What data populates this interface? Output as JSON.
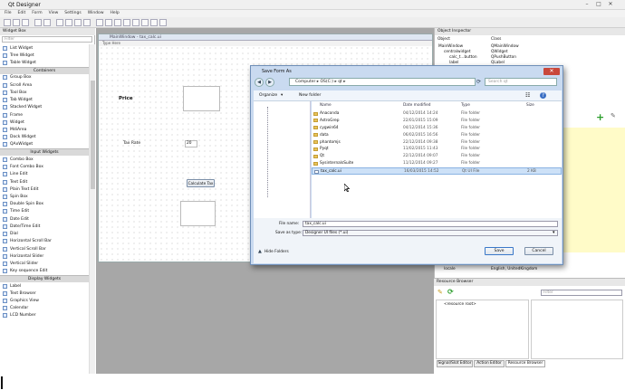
{
  "app": {
    "title": "Qt Designer",
    "menu": [
      "File",
      "Edit",
      "Form",
      "View",
      "Settings",
      "Window",
      "Help"
    ],
    "window_controls": [
      "–",
      "□",
      "✕"
    ]
  },
  "widget_box": {
    "title": "Widget Box",
    "filter_placeholder": "Filter",
    "items": [
      {
        "label": "List Widget"
      },
      {
        "label": "Tree Widget"
      },
      {
        "label": "Table Widget"
      },
      {
        "category": "Containers"
      },
      {
        "label": "Group Box"
      },
      {
        "label": "Scroll Area"
      },
      {
        "label": "Tool Box"
      },
      {
        "label": "Tab Widget"
      },
      {
        "label": "Stacked Widget"
      },
      {
        "label": "Frame"
      },
      {
        "label": "Widget"
      },
      {
        "label": "MdiArea"
      },
      {
        "label": "Dock Widget"
      },
      {
        "label": "QAxWidget"
      },
      {
        "category": "Input Widgets"
      },
      {
        "label": "Combo Box"
      },
      {
        "label": "Font Combo Box"
      },
      {
        "label": "Line Edit"
      },
      {
        "label": "Text Edit"
      },
      {
        "label": "Plain Text Edit"
      },
      {
        "label": "Spin Box"
      },
      {
        "label": "Double Spin Box"
      },
      {
        "label": "Time Edit"
      },
      {
        "label": "Date Edit"
      },
      {
        "label": "Date/Time Edit"
      },
      {
        "label": "Dial"
      },
      {
        "label": "Horizontal Scroll Bar"
      },
      {
        "label": "Vertical Scroll Bar"
      },
      {
        "label": "Horizontal Slider"
      },
      {
        "label": "Vertical Slider"
      },
      {
        "label": "Key sequence Edit"
      },
      {
        "category": "Display Widgets"
      },
      {
        "label": "Label"
      },
      {
        "label": "Text Browser"
      },
      {
        "label": "Graphics View"
      },
      {
        "label": "Calendar"
      },
      {
        "label": "LCD Number"
      }
    ]
  },
  "form": {
    "window_title": "MainWindow - tax_calc.ui",
    "menu_placeholder": "Type Here",
    "price_label": "Price",
    "tax_rate_label": "Tax Rate",
    "tax_rate_value": "20",
    "calculate_button": "Calculate Tax"
  },
  "object_inspector": {
    "title": "Object Inspector",
    "col_object": "Object",
    "col_class": "Class",
    "rows": [
      {
        "object": "MainWindow",
        "class": "QMainWindow",
        "indent": 0
      },
      {
        "object": "centralwidget",
        "class": "QWidget",
        "indent": 1
      },
      {
        "object": "calc_t...button",
        "class": "QPushButton",
        "indent": 2
      },
      {
        "object": "label",
        "class": "QLabel",
        "indent": 2
      }
    ],
    "locale_property": "locale",
    "locale_value": "English, UnitedKingdom"
  },
  "resource_browser": {
    "title": "Resource Browser",
    "filter_placeholder": "Filter",
    "root_item": "<resource root>",
    "tabs": [
      "Signal/Slot Editor",
      "Action Editor",
      "Resource Browser"
    ]
  },
  "save_dialog": {
    "title": "Save Form As",
    "breadcrumb": [
      "Computer",
      "OS(C:)",
      "qt"
    ],
    "search_placeholder": "Search qt",
    "organize": "Organize",
    "new_folder": "New folder",
    "columns": [
      "Name",
      "Date modified",
      "Type",
      "Size"
    ],
    "files": [
      {
        "name": "Anaconda",
        "date": "04/12/2014 14:24",
        "type": "File folder",
        "size": ""
      },
      {
        "name": "AstroGrep",
        "date": "22/01/2015 15:09",
        "type": "File folder",
        "size": ""
      },
      {
        "name": "cygwin64",
        "date": "04/12/2014 15:36",
        "type": "File folder",
        "size": ""
      },
      {
        "name": "data",
        "date": "06/02/2015 16:56",
        "type": "File folder",
        "size": ""
      },
      {
        "name": "phantomjs",
        "date": "22/12/2014 09:38",
        "type": "File folder",
        "size": ""
      },
      {
        "name": "Pyqt",
        "date": "11/02/2015 11:43",
        "type": "File folder",
        "size": ""
      },
      {
        "name": "Qt",
        "date": "22/12/2014 09:07",
        "type": "File folder",
        "size": ""
      },
      {
        "name": "SysinternalsSuite",
        "date": "11/12/2014 09:27",
        "type": "File folder",
        "size": ""
      },
      {
        "name": "tax_calc.ui",
        "date": "16/03/2015 14:52",
        "type": "Qt UI File",
        "size": "2 KB"
      }
    ],
    "file_name_label": "File name:",
    "file_name_value": "tax_calc.ui",
    "save_type_label": "Save as type:",
    "save_type_value": "Designer UI files (*.ui)",
    "hide_folders": "Hide Folders",
    "save_button": "Save",
    "cancel_button": "Cancel"
  }
}
